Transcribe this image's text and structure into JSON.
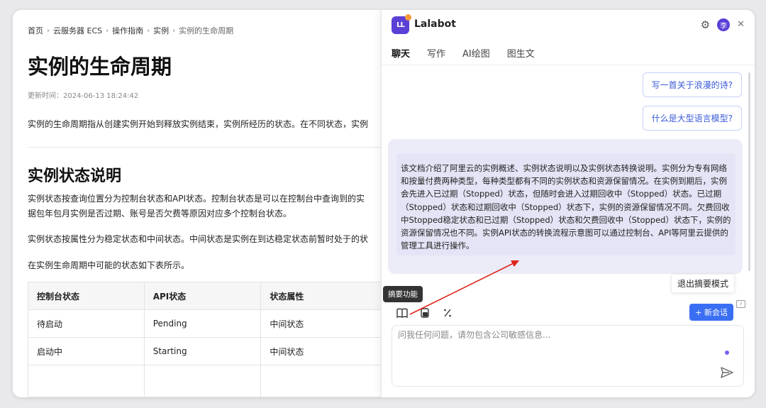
{
  "doc": {
    "breadcrumb": [
      "首页",
      "云服务器 ECS",
      "操作指南",
      "实例",
      "实例的生命周期"
    ],
    "title": "实例的生命周期",
    "updated": "更新时间：2024-06-13 18:24:42",
    "intro": "实例的生命周期指从创建实例开始到释放实例结束，实例所经历的状态。在不同状态，实例",
    "section_title": "实例状态说明",
    "para1_line1": "实例状态按查询位置分为控制台状态和API状态。控制台状态是可以在控制台中查询到的实",
    "para1_line2": "据包年包月实例是否过期、账号是否欠费等原因对应多个控制台状态。",
    "para2": "实例状态按属性分为稳定状态和中间状态。中间状态是实例在到达稳定状态前暂时处于的状",
    "para3": "在实例生命周期中可能的状态如下表所示。",
    "table": {
      "headers": [
        "控制台状态",
        "API状态",
        "状态属性"
      ],
      "rows": [
        [
          "待启动",
          "Pending",
          "中间状态"
        ],
        [
          "启动中",
          "Starting",
          "中间状态"
        ]
      ]
    }
  },
  "panel": {
    "app_name": "Lalabot",
    "logo_text": "LL",
    "avatar": "李",
    "tabs": [
      "聊天",
      "写作",
      "AI绘图",
      "图生文"
    ],
    "active_tab": 0,
    "suggestions": [
      "写一首关于浪漫的诗?",
      "什么是大型语言模型?"
    ],
    "summary": "该文档介绍了阿里云的实例概述、实例状态说明以及实例状态转换说明。实例分为专有网络和按量付费两种类型，每种类型都有不同的实例状态和资源保留情况。在实例到期后，实例会先进入已过期（Stopped）状态，但随时会进入过期回收中（Stopped）状态。已过期（Stopped）状态和过期回收中（Stopped）状态下，实例的资源保留情况不同。欠费回收中Stopped稳定状态和已过期（Stopped）状态和欠费回收中（Stopped）状态下，实例的资源保留情况也不同。实例API状态的转换流程示意图可以通过控制台、API等阿里云提供的管理工具进行操作。",
    "exit_summary": "退出摘要模式",
    "tooltip": "摘要功能",
    "new_chat": "+ 新会话",
    "input_placeholder": "问我任何问题，请勿包含公司敏感信息...",
    "accent_color": "#3b6ff3",
    "brand_color": "#5b3fd6",
    "arrow_color": "#e0241b"
  }
}
